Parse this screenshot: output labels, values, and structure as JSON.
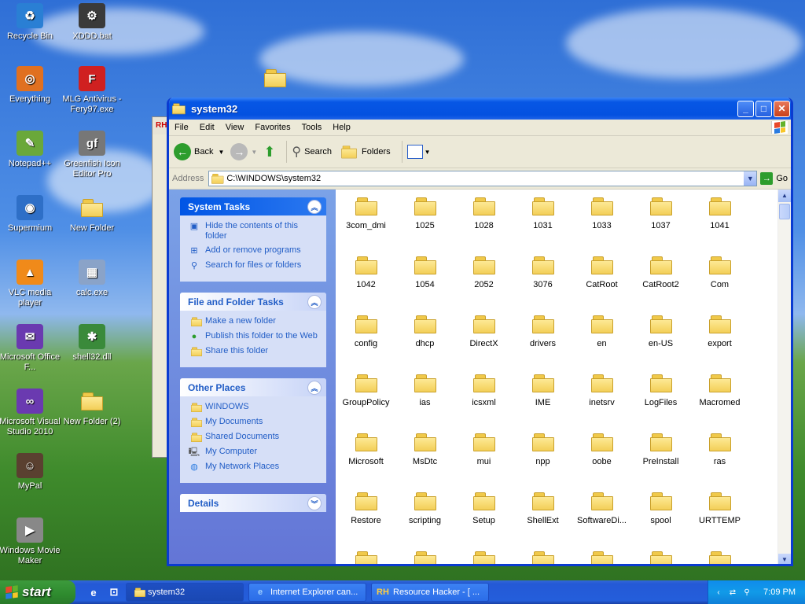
{
  "desktop": {
    "icons": [
      {
        "label": "Recycle Bin",
        "glyph": "♻",
        "color": "#2a7fd4"
      },
      {
        "label": "XDDD.bat",
        "glyph": "⚙",
        "color": "#3a3a3a"
      },
      {
        "label": "Everything",
        "glyph": "◎",
        "color": "#e07020"
      },
      {
        "label": "MLG Antivirus - Fery97.exe",
        "glyph": "F",
        "color": "#d02020"
      },
      {
        "label": "Notepad++",
        "glyph": "✎",
        "color": "#6aa83a"
      },
      {
        "label": "Greenfish Icon Editor Pro",
        "glyph": "gf",
        "color": "#777777"
      },
      {
        "label": "Supermium",
        "glyph": "◉",
        "color": "#2e6fc7"
      },
      {
        "label": "New Folder",
        "glyph": "",
        "color": "#f3cf58"
      },
      {
        "label": "VLC media player",
        "glyph": "▲",
        "color": "#f08a1a"
      },
      {
        "label": "calc.exe",
        "glyph": "▦",
        "color": "#8aa3c8"
      },
      {
        "label": "Microsoft Office F...",
        "glyph": "✉",
        "color": "#6a3ab0"
      },
      {
        "label": "shell32.dll",
        "glyph": "✱",
        "color": "#3a8a3a"
      },
      {
        "label": "Microsoft Visual Studio 2010",
        "glyph": "∞",
        "color": "#6a3ab0"
      },
      {
        "label": "New Folder (2)",
        "glyph": "",
        "color": "#f3cf58"
      },
      {
        "label": "MyPal",
        "glyph": "☺",
        "color": "#5a4030"
      },
      {
        "label": "Windows Movie Maker",
        "glyph": "▶",
        "color": "#888888"
      }
    ]
  },
  "background_window": {
    "title": "RH"
  },
  "window": {
    "title": "system32",
    "menu": [
      "File",
      "Edit",
      "View",
      "Favorites",
      "Tools",
      "Help"
    ],
    "toolbar": {
      "back": "Back",
      "search": "Search",
      "folders": "Folders"
    },
    "address": {
      "label": "Address",
      "value": "C:\\WINDOWS\\system32",
      "go": "Go"
    },
    "panels": {
      "system_tasks": {
        "title": "System Tasks",
        "items": [
          "Hide the contents of this folder",
          "Add or remove programs",
          "Search for files or folders"
        ]
      },
      "file_tasks": {
        "title": "File and Folder Tasks",
        "items": [
          "Make a new folder",
          "Publish this folder to the Web",
          "Share this folder"
        ]
      },
      "other_places": {
        "title": "Other Places",
        "items": [
          "WINDOWS",
          "My Documents",
          "Shared Documents",
          "My Computer",
          "My Network Places"
        ]
      },
      "details": {
        "title": "Details"
      }
    },
    "folders": [
      "3com_dmi",
      "1025",
      "1028",
      "1031",
      "1033",
      "1037",
      "1041",
      "1042",
      "1054",
      "2052",
      "3076",
      "CatRoot",
      "CatRoot2",
      "Com",
      "config",
      "dhcp",
      "DirectX",
      "drivers",
      "en",
      "en-US",
      "export",
      "GroupPolicy",
      "ias",
      "icsxml",
      "IME",
      "inetsrv",
      "LogFiles",
      "Macromed",
      "Microsoft",
      "MsDtc",
      "mui",
      "npp",
      "oobe",
      "PreInstall",
      "ras",
      "Restore",
      "scripting",
      "Setup",
      "ShellExt",
      "SoftwareDi...",
      "spool",
      "URTTEMP",
      "",
      "",
      "",
      "",
      "",
      "",
      ""
    ]
  },
  "taskbar": {
    "start": "start",
    "buttons": [
      {
        "label": "system32",
        "icon": "folder"
      },
      {
        "label": "Internet Explorer can...",
        "icon": "ie"
      },
      {
        "label": "Resource Hacker - [ ...",
        "icon": "rh"
      }
    ],
    "clock": "7:09 PM"
  }
}
